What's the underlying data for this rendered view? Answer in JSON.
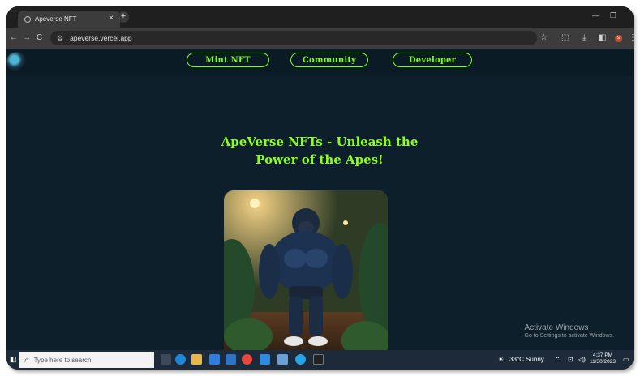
{
  "browser": {
    "tab_title": "Apeverse NFT",
    "tab_close": "×",
    "new_tab": "+",
    "url": "apeverse.vercel.app",
    "minimize": "—",
    "maximize": "❐",
    "back": "←",
    "forward": "→",
    "reload": "C",
    "star": "☆",
    "extensions": "⬚",
    "download": "⤓",
    "sidepanel": "◧",
    "profile": "s",
    "menu": "⋮"
  },
  "site": {
    "nav": [
      {
        "label": "Mint NFT"
      },
      {
        "label": "Community"
      },
      {
        "label": "Developer"
      }
    ],
    "hero_line1": "ApeVerse NFTs - Unleash the",
    "hero_line2": "Power of the Apes!"
  },
  "watermark": {
    "title": "Activate Windows",
    "subtitle": "Go to Settings to activate Windows."
  },
  "taskbar": {
    "search_placeholder": "Type here to search",
    "weather": "33°C  Sunny",
    "time": "4:37 PM",
    "date": "11/30/2023"
  },
  "colors": {
    "accent": "#7cff1a",
    "page_bg": "#0d1f2b"
  }
}
